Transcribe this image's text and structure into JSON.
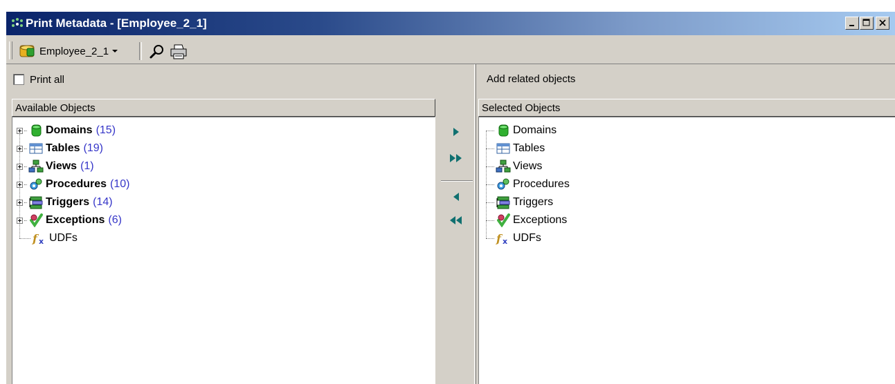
{
  "window": {
    "title": "Print Metadata - [Employee_2_1]",
    "controls": {
      "minimize": "minimize-icon",
      "maximize": "maximize-icon",
      "close": "close-icon"
    }
  },
  "toolbar": {
    "database": "Employee_2_1",
    "icons": [
      "database-icon",
      "dropdown-arrow-icon",
      "find-icon",
      "printer-icon"
    ]
  },
  "left_panel": {
    "print_all_label": "Print all",
    "print_all_checked": false,
    "header": "Available Objects",
    "items": [
      {
        "label": "Domains",
        "count": "(15)",
        "icon": "domain-icon"
      },
      {
        "label": "Tables",
        "count": "(19)",
        "icon": "table-icon"
      },
      {
        "label": "Views",
        "count": "(1)",
        "icon": "view-icon"
      },
      {
        "label": "Procedures",
        "count": "(10)",
        "icon": "procedure-icon"
      },
      {
        "label": "Triggers",
        "count": "(14)",
        "icon": "trigger-icon"
      },
      {
        "label": "Exceptions",
        "count": "(6)",
        "icon": "exception-icon"
      },
      {
        "label": "UDFs",
        "count": "",
        "icon": "udf-icon"
      }
    ]
  },
  "middle_buttons": [
    "add-icon",
    "add-all-icon",
    "remove-icon",
    "remove-all-icon"
  ],
  "right_panel": {
    "add_related_label": "Add related objects",
    "header": "Selected Objects",
    "items": [
      {
        "label": "Domains",
        "icon": "domain-icon"
      },
      {
        "label": "Tables",
        "icon": "table-icon"
      },
      {
        "label": "Views",
        "icon": "view-icon"
      },
      {
        "label": "Procedures",
        "icon": "procedure-icon"
      },
      {
        "label": "Triggers",
        "icon": "trigger-icon"
      },
      {
        "label": "Exceptions",
        "icon": "exception-icon"
      },
      {
        "label": "UDFs",
        "icon": "udf-icon"
      }
    ]
  },
  "colors": {
    "title_gradient_start": "#0a246a",
    "title_gradient_end": "#a6caf0",
    "count_text": "#3535c8",
    "arrow_green": "#107070"
  }
}
